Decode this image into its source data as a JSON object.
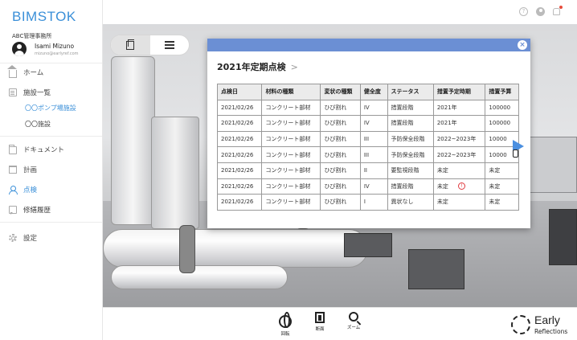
{
  "sidebar": {
    "logo": "BIMSTOK",
    "office": "ABC管理事務所",
    "user_name": "Isami Mizuno",
    "user_email": "mizuno@earlyref.com",
    "items": [
      {
        "label": "ホーム",
        "icon": "home-icon"
      },
      {
        "label": "施設一覧",
        "icon": "document-icon"
      },
      {
        "label": "〇〇ポンプ場施設",
        "icon": null
      },
      {
        "label": "〇〇施設",
        "icon": null
      },
      {
        "label": "ドキュメント",
        "icon": "folder-icon"
      },
      {
        "label": "計画",
        "icon": "calendar-icon"
      },
      {
        "label": "点検",
        "icon": "person-icon"
      },
      {
        "label": "修繕履歴",
        "icon": "chat-icon"
      },
      {
        "label": "設定",
        "icon": "gear-icon"
      }
    ]
  },
  "topbar": {
    "icons": [
      "help-icon",
      "user-icon",
      "bell-icon"
    ]
  },
  "panel": {
    "title": "2021年定期点検",
    "columns": [
      "点検日",
      "材料の種類",
      "変状の種類",
      "健全度",
      "ステータス",
      "措置予定時期",
      "措置予算"
    ],
    "rows": [
      [
        "2021/02/26",
        "コンクリート部材",
        "ひび割れ",
        "IV",
        "措置段階",
        "2021年",
        "100000"
      ],
      [
        "2021/02/26",
        "コンクリート部材",
        "ひび割れ",
        "IV",
        "措置段階",
        "2021年",
        "100000"
      ],
      [
        "2021/02/26",
        "コンクリート部材",
        "ひび割れ",
        "III",
        "予防保全段階",
        "2022~2023年",
        "10000"
      ],
      [
        "2021/02/26",
        "コンクリート部材",
        "ひび割れ",
        "III",
        "予防保全段階",
        "2022~2023年",
        "10000"
      ],
      [
        "2021/02/26",
        "コンクリート部材",
        "ひび割れ",
        "II",
        "要監視段階",
        "未定",
        "未定"
      ],
      [
        "2021/02/26",
        "コンクリート部材",
        "ひび割れ",
        "IV",
        "措置段階",
        "未定",
        "未定"
      ],
      [
        "2021/02/26",
        "コンクリート部材",
        "ひび割れ",
        "I",
        "異状なし",
        "未定",
        "未定"
      ]
    ],
    "warn_row": 5,
    "warn_symbol": "!"
  },
  "toolbar": {
    "rotate_label": "回転",
    "page_label": "断面",
    "zoom_label": "ズーム"
  },
  "brand": {
    "line1": "Early",
    "line2": "Reflections"
  },
  "colors": {
    "accent": "#3a8fd8",
    "panel_header": "#6b8fd4",
    "warning": "#e0393e"
  }
}
